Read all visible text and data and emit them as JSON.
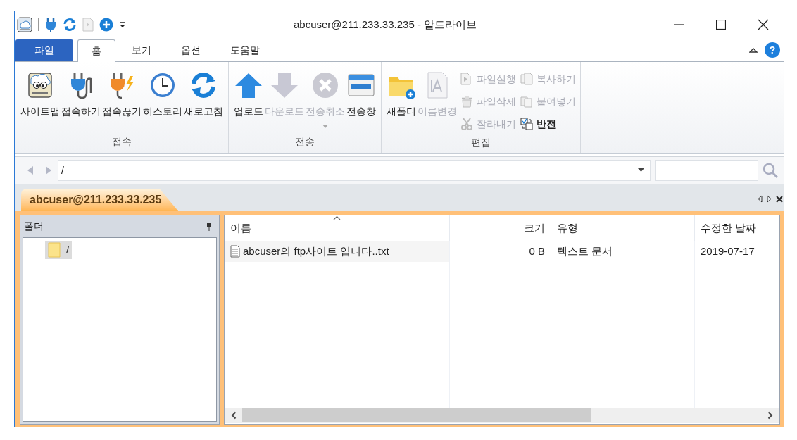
{
  "window": {
    "title": "abcuser@211.233.33.235 - 알드라이브"
  },
  "ribbon_tabs": [
    {
      "label": "파일",
      "kind": "file",
      "selected": false
    },
    {
      "label": "홈",
      "kind": "tab",
      "selected": true
    },
    {
      "label": "보기",
      "kind": "tab",
      "selected": false
    },
    {
      "label": "옵션",
      "kind": "tab",
      "selected": false
    },
    {
      "label": "도움말",
      "kind": "tab",
      "selected": false
    }
  ],
  "ribbon_groups": [
    {
      "label": "접속",
      "buttons": [
        {
          "label": "사이트맵",
          "kind": "sitemap",
          "disabled": false
        },
        {
          "label": "접속하기",
          "kind": "connect",
          "disabled": false
        },
        {
          "label": "접속끊기",
          "kind": "disconnect",
          "disabled": false
        },
        {
          "label": "히스토리",
          "kind": "history",
          "disabled": false
        },
        {
          "label": "새로고침",
          "kind": "refresh",
          "disabled": false
        }
      ]
    },
    {
      "label": "전송",
      "buttons": [
        {
          "label": "업로드",
          "kind": "upload",
          "disabled": false
        },
        {
          "label": "다운로드",
          "kind": "download",
          "disabled": true
        },
        {
          "label": "전송취소",
          "kind": "cancel",
          "disabled": true,
          "dropdown": true
        },
        {
          "label": "전송창",
          "kind": "transfer",
          "disabled": false
        }
      ]
    },
    {
      "label": "편집",
      "buttons": [
        {
          "label": "새폴더",
          "kind": "newfolder",
          "disabled": false
        },
        {
          "label": "이름변경",
          "kind": "rename",
          "disabled": true
        }
      ],
      "small_buttons": [
        {
          "label": "파일실행",
          "kind": "run",
          "disabled": true
        },
        {
          "label": "파일삭제",
          "kind": "delete",
          "disabled": true
        },
        {
          "label": "잘라내기",
          "kind": "cut",
          "disabled": true
        },
        {
          "label": "복사하기",
          "kind": "copy",
          "disabled": true
        },
        {
          "label": "붙여넣기",
          "kind": "paste",
          "disabled": true
        },
        {
          "label": "반전",
          "kind": "invert",
          "disabled": false
        }
      ]
    }
  ],
  "address": {
    "path": "/"
  },
  "session_tabs": [
    {
      "label": "abcuser@211.233.33.235",
      "selected": true
    }
  ],
  "folder_pane": {
    "title": "폴더",
    "tree": [
      {
        "label": "/",
        "selected": true
      }
    ]
  },
  "help_button": {
    "label": "?"
  },
  "file_list": {
    "columns": [
      {
        "label": "이름",
        "sorted": true,
        "kind": "text"
      },
      {
        "label": "크기",
        "sorted": false,
        "kind": "number"
      },
      {
        "label": "유형",
        "sorted": false,
        "kind": "text"
      },
      {
        "label": "수정한 날짜",
        "sorted": false,
        "kind": "text"
      }
    ],
    "rows": [
      {
        "cells": [
          "abcuser의 ftp사이트 입니다..txt",
          "0 B",
          "텍스트 문서",
          "2019-07-17"
        ]
      }
    ]
  }
}
